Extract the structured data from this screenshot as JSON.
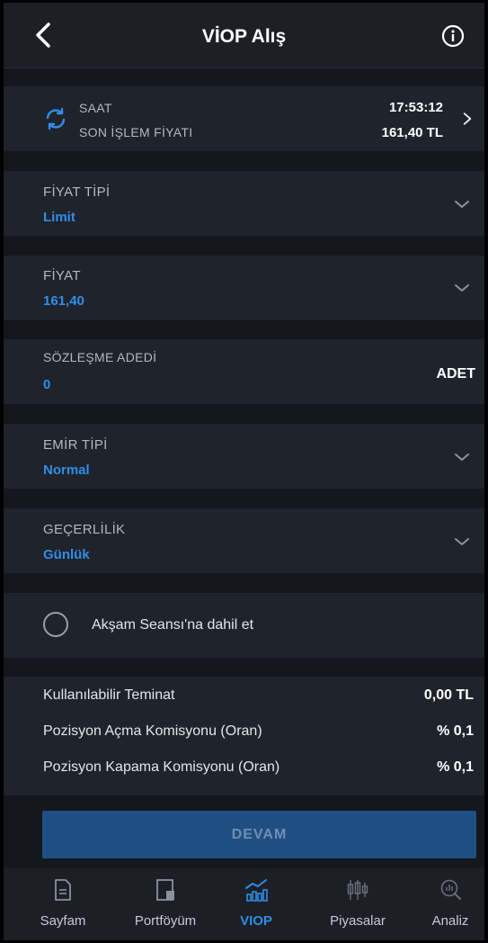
{
  "header": {
    "title": "VİOP Alış"
  },
  "price_card": {
    "time_label": "SAAT",
    "time_value": "17:53:12",
    "last_price_label": "SON İŞLEM FİYATI",
    "last_price_value": "161,40 TL"
  },
  "fields": {
    "price_type": {
      "label": "FİYAT TİPİ",
      "value": "Limit"
    },
    "price": {
      "label": "FİYAT",
      "value": "161,40"
    },
    "contract_qty": {
      "label": "SÖZLEŞME ADEDİ",
      "value": "0",
      "unit": "ADET"
    },
    "order_type": {
      "label": "EMİR TİPİ",
      "value": "Normal"
    },
    "validity": {
      "label": "GEÇERLİLİK",
      "value": "Günlük"
    }
  },
  "evening_session": {
    "label": "Akşam Seansı'na dahil et",
    "checked": false
  },
  "summary": {
    "rows": [
      {
        "label": "Kullanılabilir Teminat",
        "value": "0,00 TL"
      },
      {
        "label": "Pozisyon Açma Komisyonu (Oran)",
        "value": "% 0,1"
      },
      {
        "label": "Pozisyon Kapama Komisyonu (Oran)",
        "value": "% 0,1"
      }
    ]
  },
  "actions": {
    "continue_label": "DEVAM"
  },
  "bottom_nav": {
    "items": [
      {
        "label": "Sayfam",
        "icon": "document-icon"
      },
      {
        "label": "Portföyüm",
        "icon": "portfolio-icon"
      },
      {
        "label": "VIOP",
        "icon": "viop-chart-icon"
      },
      {
        "label": "Piyasalar",
        "icon": "candlestick-icon"
      },
      {
        "label": "Analiz",
        "icon": "analysis-icon"
      }
    ],
    "active": "VIOP"
  },
  "colors": {
    "background": "#14171d",
    "card": "#1f232b",
    "accent": "#2f8ee8",
    "button": "#1f4f82"
  }
}
